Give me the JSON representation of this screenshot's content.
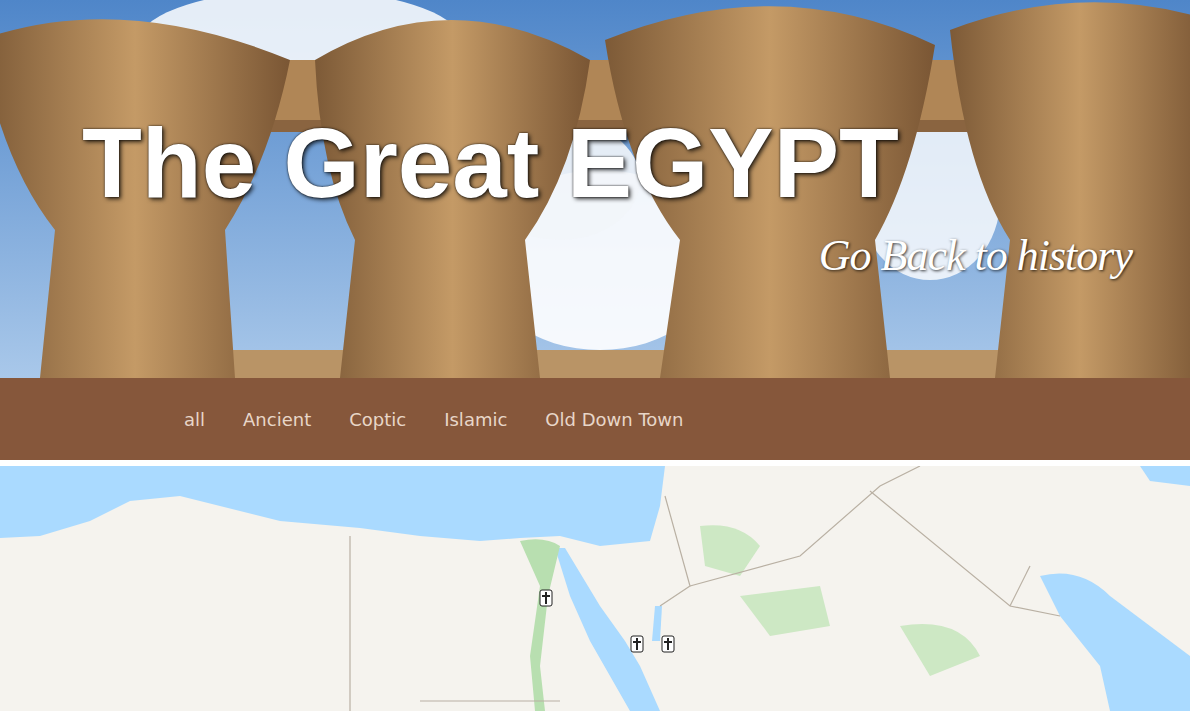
{
  "header": {
    "title": "The Great EGYPT",
    "tagline": "Go Back to history"
  },
  "nav": {
    "items": [
      {
        "label": "all"
      },
      {
        "label": "Ancient"
      },
      {
        "label": "Coptic"
      },
      {
        "label": "Islamic"
      },
      {
        "label": "Old Down Town"
      }
    ]
  }
}
